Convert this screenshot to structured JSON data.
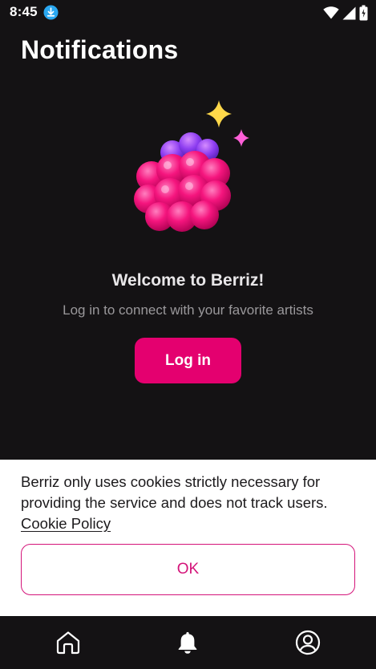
{
  "status_bar": {
    "time": "8:45",
    "icons": [
      "download-icon",
      "wifi-icon",
      "signal-icon",
      "battery-icon"
    ]
  },
  "header": {
    "title": "Notifications"
  },
  "empty_state": {
    "illustration": "raspberry-with-sparkles",
    "title": "Welcome to Berriz!",
    "subtitle": "Log in to connect with your favorite artists",
    "login_label": "Log in"
  },
  "cookie_banner": {
    "message": "Berriz only uses cookies strictly necessary for providing the service and does not track users.",
    "link_label": "Cookie Policy",
    "ok_label": "OK"
  },
  "bottom_nav": {
    "items": [
      {
        "icon": "home-icon",
        "active": false
      },
      {
        "icon": "bell-icon",
        "active": true
      },
      {
        "icon": "profile-icon",
        "active": false
      }
    ]
  },
  "colors": {
    "background": "#141214",
    "accent": "#e4006f",
    "banner_background": "#ffffff"
  }
}
